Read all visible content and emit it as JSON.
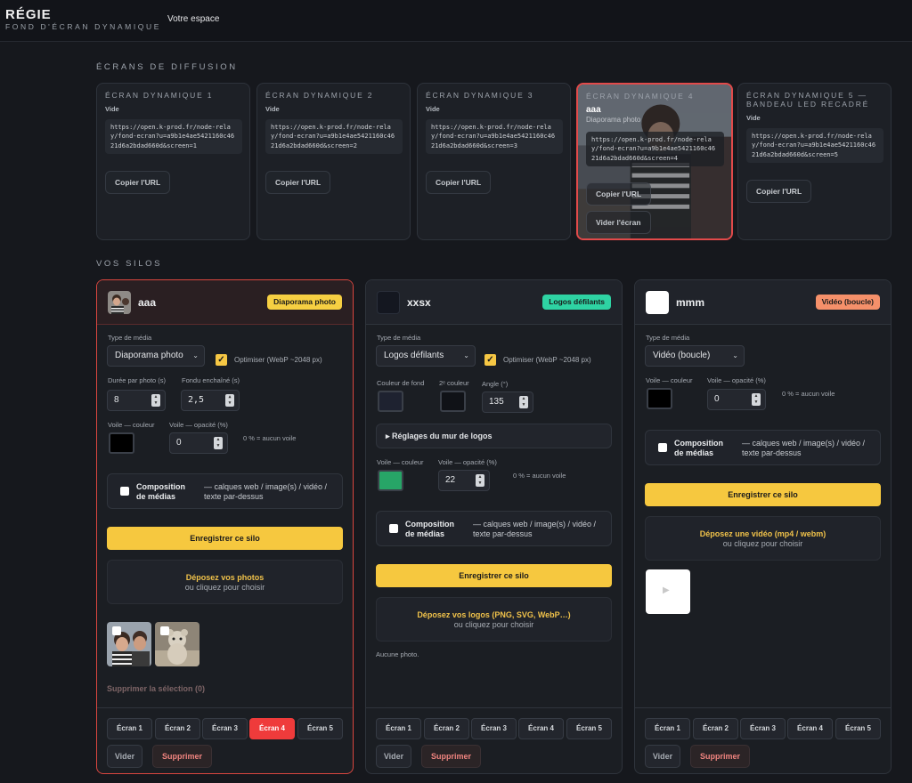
{
  "header": {
    "title": "RÉGIE",
    "subtitle": "FOND D'ÉCRAN DYNAMIQUE",
    "nav_label": "Votre espace"
  },
  "screens_section": {
    "title": "ÉCRANS DE DIFFUSION",
    "cards": [
      {
        "title": "ÉCRAN DYNAMIQUE 1",
        "status": "Vide",
        "url": "https://open.k-prod.fr/node-relay/fond-ecran?u=a9b1e4ae5421160c4621d6a2bdad660d&screen=1",
        "copy_label": "Copier l'URL"
      },
      {
        "title": "ÉCRAN DYNAMIQUE 2",
        "status": "Vide",
        "url": "https://open.k-prod.fr/node-relay/fond-ecran?u=a9b1e4ae5421160c4621d6a2bdad660d&screen=2",
        "copy_label": "Copier l'URL"
      },
      {
        "title": "ÉCRAN DYNAMIQUE 3",
        "status": "Vide",
        "url": "https://open.k-prod.fr/node-relay/fond-ecran?u=a9b1e4ae5421160c4621d6a2bdad660d&screen=3",
        "copy_label": "Copier l'URL"
      },
      {
        "title": "ÉCRAN DYNAMIQUE 4",
        "silo_name": "aaa",
        "silo_type": "Diaporama photo",
        "url": "https://open.k-prod.fr/node-relay/fond-ecran?u=a9b1e4ae5421160c4621d6a2bdad660d&screen=4",
        "copy_label": "Copier l'URL",
        "clear_label": "Vider l'écran"
      },
      {
        "title": "ÉCRAN DYNAMIQUE 5 — BANDEAU LED RECADRÉ",
        "status": "Vide",
        "url": "https://open.k-prod.fr/node-relay/fond-ecran?u=a9b1e4ae5421160c4621d6a2bdad660d&screen=5",
        "copy_label": "Copier l'URL"
      }
    ]
  },
  "silos_section": {
    "title": "VOS SILOS",
    "silos": [
      {
        "name": "aaa",
        "badge": "Diaporama photo",
        "badge_color": "#f6cf42",
        "media_type_label": "Type de média",
        "media_type": "Diaporama photo",
        "optimize_label": "Optimiser (WebP ~2048 px)",
        "duration_label": "Durée par photo (s)",
        "duration": "8",
        "fade_label": "Fondu enchaîné (s)",
        "fade": "2,5",
        "veil_color_label": "Voile — couleur",
        "veil_color": "#000000",
        "veil_opacity_label": "Voile — opacité (%)",
        "veil_opacity": "0",
        "veil_hint": "0 % = aucun voile",
        "compo_title": "Composition de médias",
        "compo_desc": "— calques web / image(s) / vidéo / texte par-dessus",
        "save_label": "Enregistrer ce silo",
        "drop_title": "Déposez vos photos",
        "drop_sub": "ou cliquez pour choisir",
        "delete_selection": "Supprimer la sélection (0)",
        "screens": [
          "Écran 1",
          "Écran 2",
          "Écran 3",
          "Écran 4",
          "Écran 5"
        ],
        "clear_label": "Vider",
        "delete_label": "Supprimer"
      },
      {
        "name": "xxsx",
        "badge": "Logos défilants",
        "badge_color": "#2ed3a3",
        "media_type_label": "Type de média",
        "media_type": "Logos défilants",
        "optimize_label": "Optimiser (WebP ~2048 px)",
        "bg_color_label": "Couleur de fond",
        "bg_color": "#1e2230",
        "second_color_label": "2ᵉ couleur",
        "second_color": "#101217",
        "angle_label": "Angle (°)",
        "angle": "135",
        "wall_label": "▸ Réglages du mur de logos",
        "veil_color_label": "Voile — couleur",
        "veil_color": "#27a567",
        "veil_opacity_label": "Voile — opacité (%)",
        "veil_opacity": "22",
        "veil_hint": "0 % = aucun voile",
        "compo_title": "Composition de médias",
        "compo_desc": "— calques web / image(s) / vidéo / texte par-dessus",
        "save_label": "Enregistrer ce silo",
        "drop_title": "Déposez vos logos (PNG, SVG, WebP…)",
        "drop_sub": "ou cliquez pour choisir",
        "no_photo": "Aucune photo.",
        "screens": [
          "Écran 1",
          "Écran 2",
          "Écran 3",
          "Écran 4",
          "Écran 5"
        ],
        "clear_label": "Vider",
        "delete_label": "Supprimer"
      },
      {
        "name": "mmm",
        "badge": "Vidéo (boucle)",
        "badge_color": "#f5906a",
        "media_type_label": "Type de média",
        "media_type": "Vidéo (boucle)",
        "veil_color_label": "Voile — couleur",
        "veil_color": "#000000",
        "veil_opacity_label": "Voile — opacité (%)",
        "veil_opacity": "0",
        "veil_hint": "0 % = aucun voile",
        "compo_title": "Composition de médias",
        "compo_desc": "— calques web / image(s) / vidéo / texte par-dessus",
        "save_label": "Enregistrer ce silo",
        "drop_title": "Déposez une vidéo (mp4 / webm)",
        "drop_sub": "ou cliquez pour choisir",
        "screens": [
          "Écran 1",
          "Écran 2",
          "Écran 3",
          "Écran 4",
          "Écran 5"
        ],
        "clear_label": "Vider",
        "delete_label": "Supprimer"
      }
    ]
  }
}
